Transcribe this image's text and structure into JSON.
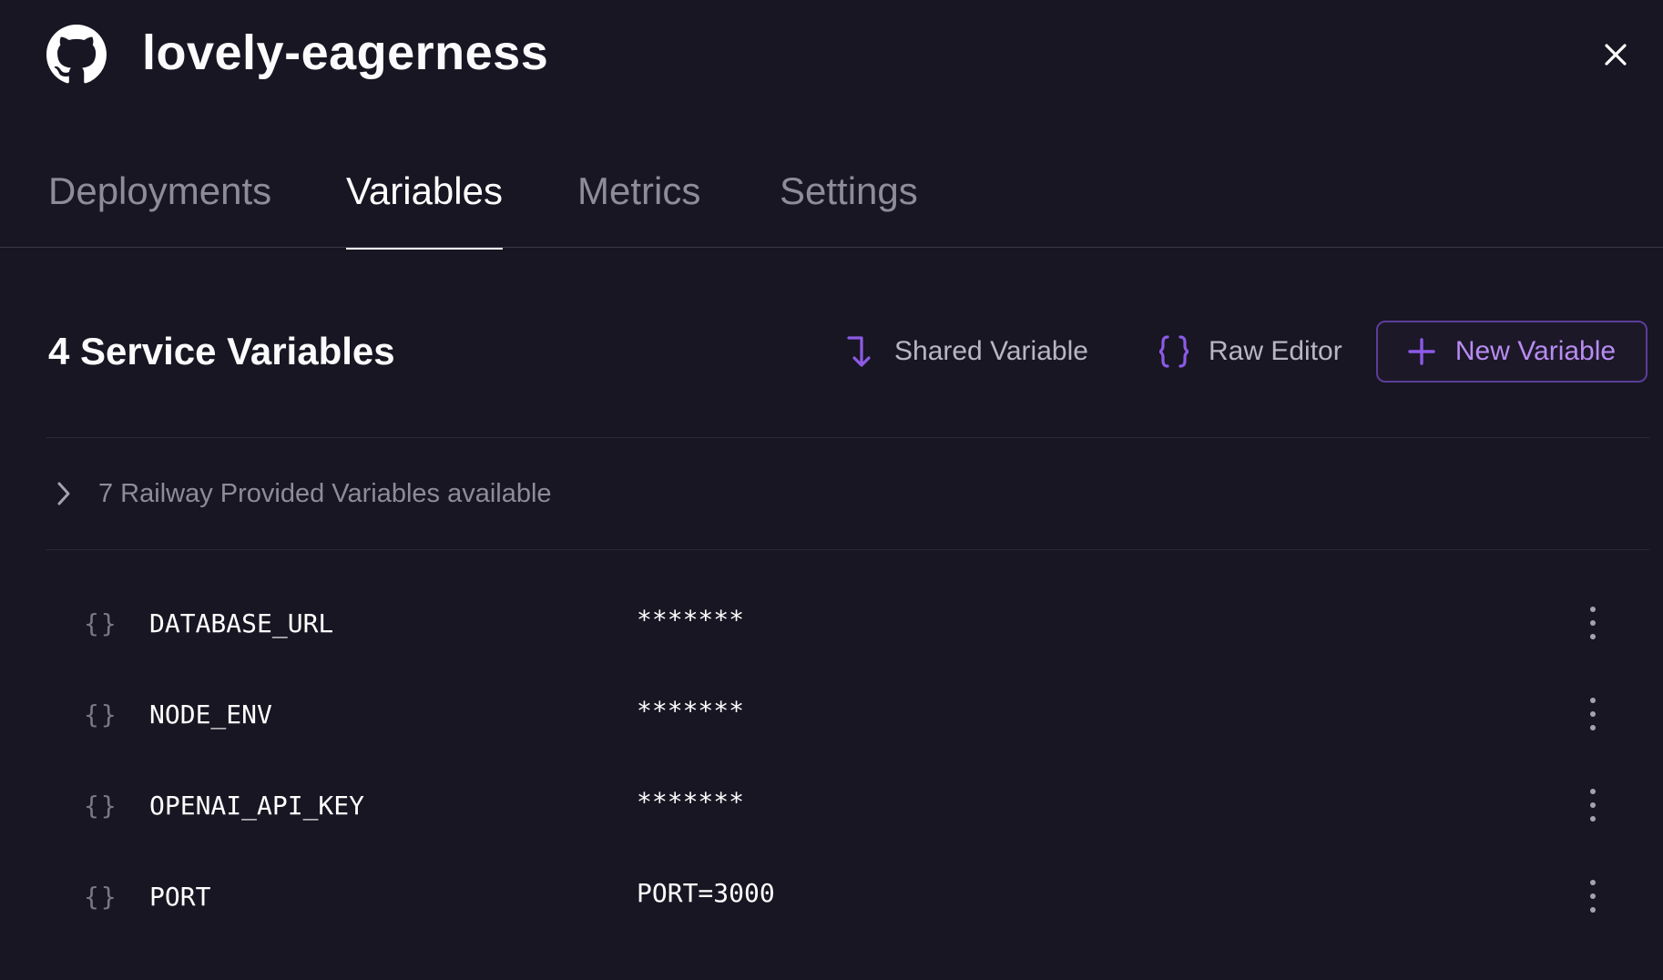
{
  "header": {
    "title": "lovely-eagerness",
    "repo_icon": "github-icon",
    "close_icon": "close-icon"
  },
  "tabs": [
    {
      "label": "Deployments",
      "active": false
    },
    {
      "label": "Variables",
      "active": true
    },
    {
      "label": "Metrics",
      "active": false
    },
    {
      "label": "Settings",
      "active": false
    }
  ],
  "variables_section": {
    "title": "4 Service Variables",
    "shared_variable_label": "Shared Variable",
    "raw_editor_label": "Raw Editor",
    "new_variable_label": "New Variable",
    "provided_label": "7 Railway Provided Variables available"
  },
  "variables": [
    {
      "brace": "{}",
      "name": "DATABASE_URL",
      "value": "*******"
    },
    {
      "brace": "{}",
      "name": "NODE_ENV",
      "value": "*******"
    },
    {
      "brace": "{}",
      "name": "OPENAI_API_KEY",
      "value": "*******"
    },
    {
      "brace": "{}",
      "name": "PORT",
      "value": "PORT=3000"
    }
  ],
  "colors": {
    "background": "#181622",
    "accent": "#8c5ae6",
    "accent_text": "#b88cf2",
    "muted_text": "#8e8c98"
  }
}
